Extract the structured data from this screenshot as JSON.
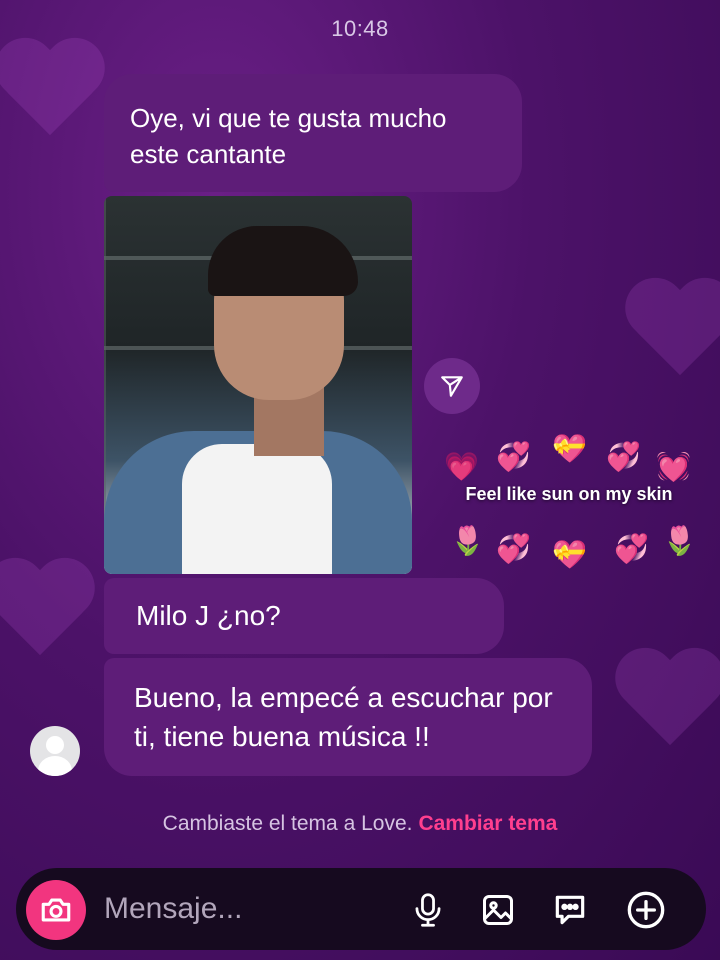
{
  "status": {
    "time": "10:48"
  },
  "messages": [
    {
      "text": "Oye, vi que te gusta mucho este cantante"
    },
    {
      "text": "Milo J  ¿no?"
    },
    {
      "text": "Bueno, la empecé a escuchar por ti, tiene buena música !!"
    }
  ],
  "sticker": {
    "text": "Feel like sun on my skin",
    "emojis": [
      "💗",
      "💞",
      "💝",
      "💞",
      "💓",
      "🌷",
      "💞",
      "💝",
      "💞",
      "🌷"
    ]
  },
  "theme_note": {
    "text": "Cambiaste el tema a Love.",
    "link": "Cambiar tema"
  },
  "composer": {
    "placeholder": "Mensaje..."
  },
  "colors": {
    "accent": "#f2357f",
    "link": "#ff3f8e",
    "bubble": "#5e1d78"
  }
}
